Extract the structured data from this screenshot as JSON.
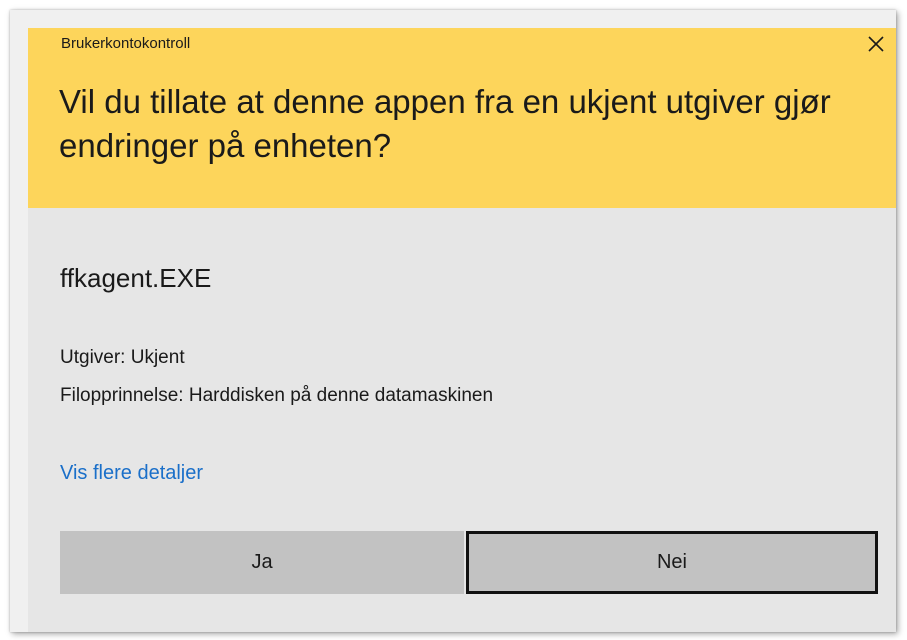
{
  "header": {
    "title": "Brukerkontokontroll",
    "question": "Vil du tillate at denne appen fra en ukjent utgiver gjør endringer på enheten?",
    "close_icon": "close-icon",
    "background_color": "#fdd55b"
  },
  "body": {
    "app_name": "ffkagent.EXE",
    "publisher": "Utgiver: Ukjent",
    "origin": "Filopprinnelse: Harddisken på denne datamaskinen",
    "details_link": "Vis flere detaljer",
    "link_color": "#1a6fc9"
  },
  "buttons": {
    "yes_label": "Ja",
    "no_label": "Nei"
  }
}
